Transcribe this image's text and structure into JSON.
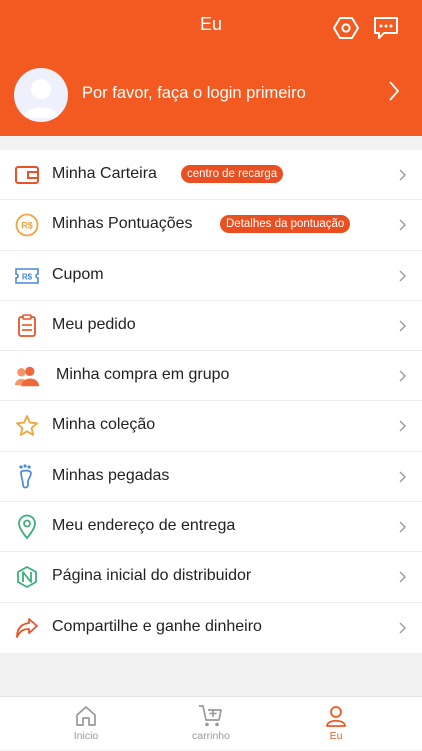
{
  "header": {
    "title": "Eu",
    "login_text": "Por favor, faça o login primeiro",
    "icons": [
      "settings-icon",
      "message-icon",
      "avatar-icon",
      "chevron-right-icon"
    ]
  },
  "menu": {
    "items": [
      {
        "label": "Minha Carteira",
        "badge": "centro de recarga",
        "icon": "wallet-icon"
      },
      {
        "label": "Minhas Pontuações",
        "badge": "Detalhes da pontuação",
        "icon": "points-icon"
      },
      {
        "label": "Cupom",
        "icon": "coupon-icon"
      },
      {
        "label": "Meu pedido",
        "icon": "order-icon"
      },
      {
        "label": "Minha compra em grupo",
        "icon": "group-icon"
      },
      {
        "label": "Minha coleção",
        "icon": "star-icon"
      },
      {
        "label": "Minhas pegadas",
        "icon": "footprint-icon"
      },
      {
        "label": "Meu endereço de entrega",
        "icon": "location-icon"
      },
      {
        "label": "Página inicial do distribuidor",
        "icon": "distributor-icon"
      },
      {
        "label": "Compartilhe e ganhe dinheiro",
        "icon": "share-icon"
      }
    ]
  },
  "tabbar": {
    "tabs": [
      {
        "label": "Inicio",
        "icon": "home-icon"
      },
      {
        "label": "carrinho",
        "icon": "cart-icon"
      },
      {
        "label": "Eu",
        "icon": "user-icon",
        "active": true
      }
    ]
  },
  "colors": {
    "brand": "#f25a22",
    "badge": "#ea4f22"
  }
}
